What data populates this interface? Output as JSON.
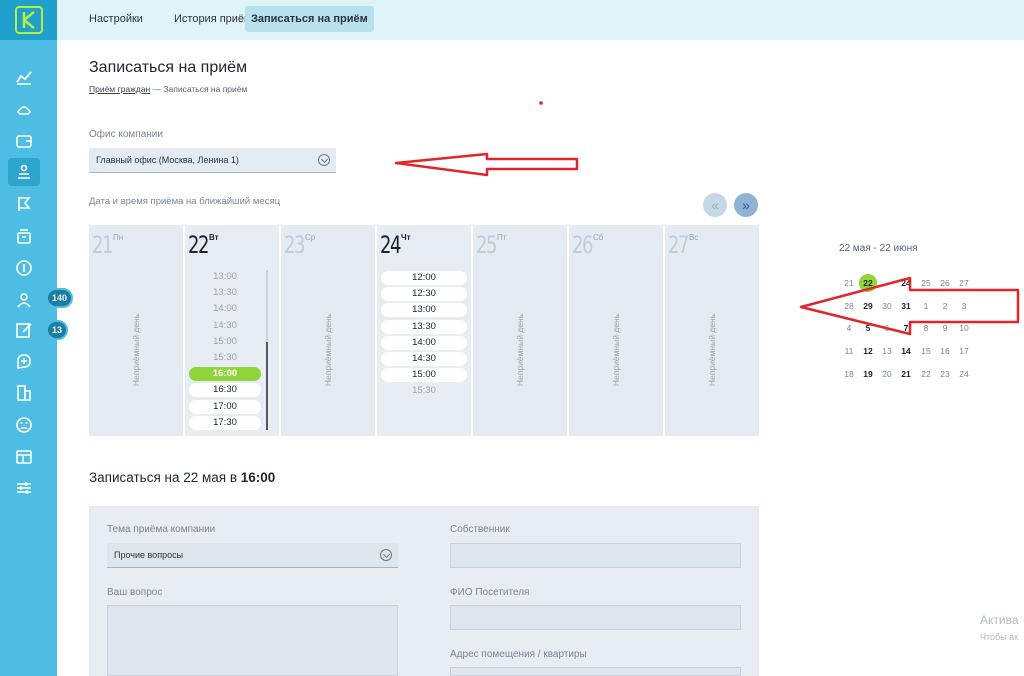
{
  "topbar": {
    "tabs": [
      {
        "label": "Настройки"
      },
      {
        "label": "История приёма"
      },
      {
        "label": "Записаться на приём",
        "active": true
      }
    ]
  },
  "sidebar": {
    "icons": [
      "analytics-icon",
      "phone-icon",
      "wallet-icon",
      "reception-icon",
      "flag-icon",
      "archive-icon",
      "coin-icon",
      "people-icon",
      "edit-icon",
      "chat-add-icon",
      "building-icon",
      "sad-face-icon",
      "dashboard-icon",
      "sliders-icon"
    ],
    "badges": {
      "people": "140",
      "edit": "13"
    },
    "accent": "#4dbde3",
    "logo_color": "#b9ef3c"
  },
  "header": {
    "title": "Записаться на приём",
    "breadcrumb_link": "Приём граждан",
    "breadcrumb_current": "— Записаться на приём"
  },
  "office": {
    "label": "Офис компании",
    "value": "Главный офис (Москва, Ленина 1)"
  },
  "schedule": {
    "label": "Дата и время приёма на ближайший месяц",
    "days": [
      {
        "num": "21",
        "name": "Пн",
        "off": "Неприёмный день"
      },
      {
        "num": "22",
        "name": "Вт",
        "slots": [
          {
            "time": "13:00",
            "state": "past"
          },
          {
            "time": "13:30",
            "state": "past"
          },
          {
            "time": "14:00",
            "state": "past"
          },
          {
            "time": "14:30",
            "state": "past"
          },
          {
            "time": "15:00",
            "state": "past"
          },
          {
            "time": "15:30",
            "state": "past"
          },
          {
            "time": "16:00",
            "state": "selected"
          },
          {
            "time": "16:30",
            "state": "free"
          },
          {
            "time": "17:00",
            "state": "free"
          },
          {
            "time": "17:30",
            "state": "free"
          }
        ]
      },
      {
        "num": "23",
        "name": "Ср",
        "off": "Неприёмный день"
      },
      {
        "num": "24",
        "name": "Чт",
        "slots": [
          {
            "time": "12:00",
            "state": "free"
          },
          {
            "time": "12:30",
            "state": "free"
          },
          {
            "time": "13:00",
            "state": "free"
          },
          {
            "time": "13:30",
            "state": "free"
          },
          {
            "time": "14:00",
            "state": "free"
          },
          {
            "time": "14:30",
            "state": "free"
          },
          {
            "time": "15:00",
            "state": "free"
          },
          {
            "time": "15:30",
            "state": "past"
          }
        ]
      },
      {
        "num": "25",
        "name": "Пт",
        "off": "Неприёмный день"
      },
      {
        "num": "26",
        "name": "Сб",
        "off": "Неприёмный день"
      },
      {
        "num": "27",
        "name": "Вс",
        "off": "Неприёмный день"
      }
    ]
  },
  "calendar": {
    "range": "22 мая - 22 июня",
    "weeks": [
      [
        {
          "d": "21"
        },
        {
          "d": "22",
          "s": "today"
        },
        {
          "d": "24",
          "s": "avail"
        },
        {
          "d": "25"
        },
        {
          "d": "26"
        },
        {
          "d": "27"
        }
      ],
      [
        {
          "d": "28"
        },
        {
          "d": "29",
          "s": "avail"
        },
        {
          "d": "30"
        },
        {
          "d": "31",
          "s": "avail"
        },
        {
          "d": "1"
        },
        {
          "d": "2"
        },
        {
          "d": "3"
        }
      ],
      [
        {
          "d": "4"
        },
        {
          "d": "5",
          "s": "avail"
        },
        {
          "d": "6"
        },
        {
          "d": "7",
          "s": "avail"
        },
        {
          "d": "8"
        },
        {
          "d": "9"
        },
        {
          "d": "10"
        }
      ],
      [
        {
          "d": "11"
        },
        {
          "d": "12",
          "s": "avail"
        },
        {
          "d": "13"
        },
        {
          "d": "14",
          "s": "avail"
        },
        {
          "d": "15"
        },
        {
          "d": "16"
        },
        {
          "d": "17"
        }
      ],
      [
        {
          "d": "18"
        },
        {
          "d": "19",
          "s": "avail"
        },
        {
          "d": "20"
        },
        {
          "d": "21",
          "s": "avail"
        },
        {
          "d": "22"
        },
        {
          "d": "23"
        },
        {
          "d": "24"
        }
      ]
    ]
  },
  "form": {
    "title_prefix": "Записаться на 22 мая в ",
    "title_time": "16:00",
    "topic_label": "Тема приёма компании",
    "topic_value": "Прочие вопросы",
    "question_label": "Ваш вопрос",
    "owner_label": "Собственник",
    "visitor_label": "ФИО Посетителя",
    "address_label": "Адрес помещения / квартиры"
  },
  "watermark": {
    "line1": "Актива",
    "line2": "Чтобы ак"
  },
  "annotation_color": "#e0262a"
}
